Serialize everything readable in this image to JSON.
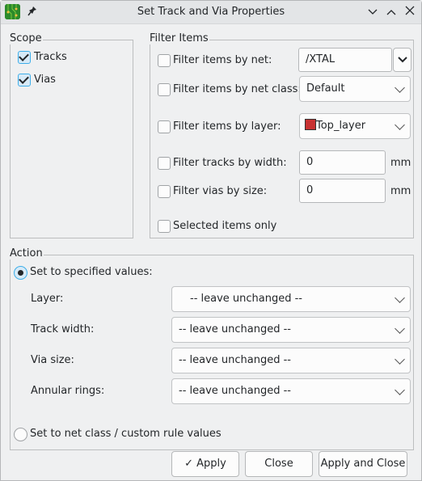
{
  "window": {
    "title": "Set Track and Via Properties",
    "icons": {
      "app": "kicad-pcb-icon",
      "pin": "pin-icon",
      "minimize": "chevron-down-icon",
      "maximize": "chevron-up-icon",
      "close": "close-icon"
    },
    "glyphs": {
      "minimize": "⌄",
      "maximize": "⌃",
      "close": "✕",
      "pin": "✎"
    }
  },
  "scope": {
    "label": "Scope",
    "tracks": {
      "label": "Tracks",
      "checked": true
    },
    "vias": {
      "label": "Vias",
      "checked": true
    }
  },
  "filter": {
    "label": "Filter Items",
    "by_net": {
      "label": "Filter items by net:",
      "checked": false,
      "value": "/XTAL"
    },
    "by_net_class": {
      "label": "Filter items by net class:",
      "checked": false,
      "value": "Default"
    },
    "by_layer": {
      "label": "Filter items by layer:",
      "checked": false,
      "value": "Top_layer",
      "swatch_color": "#c83232"
    },
    "by_width": {
      "label": "Filter tracks by width:",
      "checked": false,
      "value": "0",
      "unit": "mm"
    },
    "by_via_size": {
      "label": "Filter vias by size:",
      "checked": false,
      "value": "0",
      "unit": "mm"
    },
    "selected_only": {
      "label": "Selected items only",
      "checked": false
    }
  },
  "action": {
    "label": "Action",
    "specified": {
      "label": "Set to specified values:",
      "selected": true
    },
    "layer": {
      "label": "Layer:",
      "value": "-- leave unchanged --"
    },
    "track_width": {
      "label": "Track width:",
      "value": "-- leave unchanged --"
    },
    "via_size": {
      "label": "Via size:",
      "value": "-- leave unchanged --"
    },
    "annular_rings": {
      "label": "Annular rings:",
      "value": "-- leave unchanged --"
    },
    "netclass": {
      "label": "Set to net class / custom rule values",
      "selected": false
    }
  },
  "buttons": {
    "apply": "✓ Apply",
    "close": "Close",
    "apply_close": "Apply and Close"
  }
}
